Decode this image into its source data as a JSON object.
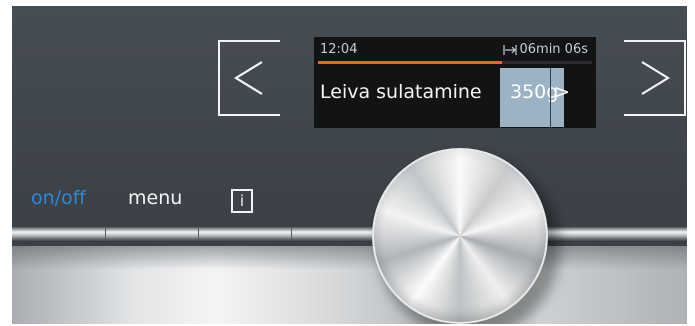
{
  "display": {
    "time": "12:04",
    "remaining_time": "06min 06s",
    "remaining_icon": "timer-end-icon",
    "program": "Leiva sulatamine",
    "weight": "350g",
    "weight_arrow": ">",
    "progress": 0.67,
    "progress_color": "#f0641e"
  },
  "controls": {
    "onoff_label": "on/off",
    "menu_label": "menu",
    "info_label": "i"
  },
  "nav": {
    "left_icon": "chevron-left-icon",
    "right_icon": "chevron-right-icon"
  },
  "colors": {
    "panel": "#3f454a",
    "onoff": "#2f87d6",
    "display_highlight": "#9bb3c5"
  }
}
